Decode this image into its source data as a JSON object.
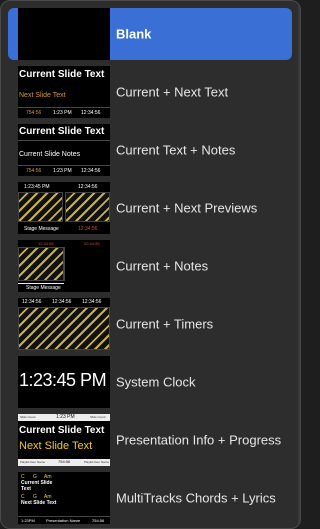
{
  "menu": {
    "items": [
      {
        "label": "Blank"
      },
      {
        "label": "Current + Next Text"
      },
      {
        "label": "Current Text + Notes"
      },
      {
        "label": "Current + Next Previews"
      },
      {
        "label": "Current + Notes"
      },
      {
        "label": "Current + Timers"
      },
      {
        "label": "System Clock"
      },
      {
        "label": "Presentation Info + Progress"
      },
      {
        "label": "MultiTracks Chords + Lyrics"
      }
    ]
  },
  "thumbs": {
    "current_next_text": {
      "current": "Current Slide Text",
      "next": "Next Slide Text",
      "timer1": "754:56",
      "clock": "1:23 PM",
      "timer2": "12:34:56"
    },
    "current_text_notes": {
      "current": "Current Slide Text",
      "notes": "Current Slide Notes",
      "timer1": "754:56",
      "clock": "1:23 PM",
      "timer2": "12:34:56"
    },
    "current_next_previews": {
      "clock": "1:23:45 PM",
      "timer": "12:34:56",
      "message": "Stage Message",
      "timer_red1": "12:34:56",
      "timer_red2": "12:34:56"
    },
    "current_notes": {
      "timer_red1": "12:34:56",
      "timer_red2": "00:34:56",
      "message": "Stage Message"
    },
    "current_timers": {
      "t1": "12:34:56",
      "t2": "12:34:56",
      "t3": "12:34:56"
    },
    "system_clock": {
      "clock": "1:23:45 PM"
    },
    "presentation_info": {
      "top1": "Slide Count",
      "top2": "1:23 PM",
      "top3": "Slide Count",
      "current": "Current Slide Text",
      "next": "Next Slide Text",
      "bottom1": "Playlist Item Name",
      "bottom2": "754:56",
      "bottom3": "Playlist Item Name"
    },
    "multitracks": {
      "chord1": "C",
      "chord2": "G",
      "chord3": "Am",
      "lyric1": "Current Slide",
      "lyric2": "Text",
      "chord4": "C",
      "chord5": "G",
      "chord6": "Am",
      "lyric3": "Next Slide Text",
      "bottom1": "1:23PM",
      "bottom2": "Presentation Name",
      "bottom3": "754:56"
    }
  }
}
